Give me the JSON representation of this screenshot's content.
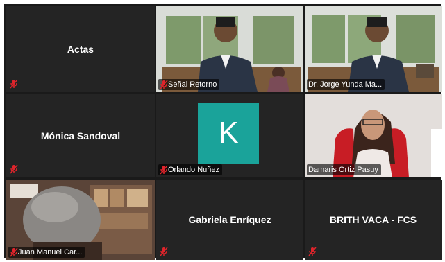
{
  "participants": [
    {
      "name": "Actas",
      "video": false
    },
    {
      "name": "Señal Retorno",
      "video": true
    },
    {
      "name": "Dr. Jorge Yunda Ma...",
      "video": true
    },
    {
      "name": "Mónica Sandoval",
      "video": false
    },
    {
      "name": "Orlando Nuñez",
      "video": false,
      "avatar_letter": "K"
    },
    {
      "name": "Damaris Ortiz Pasuy",
      "video": true
    },
    {
      "name": "Juan Manuel Car...",
      "video": true
    },
    {
      "name": "Gabriela Enríquez",
      "video": false
    },
    {
      "name": "BRITH VACA - FCS",
      "video": false
    }
  ],
  "colors": {
    "muted_mic": "#e0242b",
    "avatar_bg": "#1aa39a",
    "tile_bg": "#242424"
  },
  "icons": {
    "mic": "muted-microphone-icon"
  }
}
